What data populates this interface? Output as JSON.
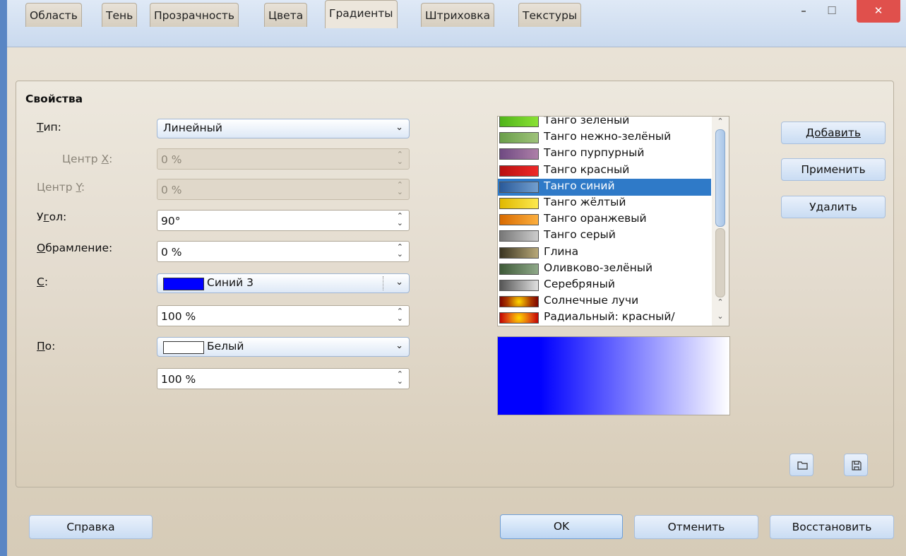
{
  "window": {
    "title": "Область",
    "minimize": "–",
    "maximize": "☐",
    "close": "✕"
  },
  "tabs": [
    "Область",
    "Тень",
    "Прозрачность",
    "Цвета",
    "Градиенты",
    "Штриховка",
    "Текстуры"
  ],
  "active_tab": "Градиенты",
  "properties": {
    "title": "Свойства",
    "type_label_u": "Т",
    "type_label_rest": "ип:",
    "type_value": "Линейный",
    "center_x_label_pre": "Центр ",
    "center_x_label_u": "X",
    "center_x_label_post": ":",
    "center_x_value": "0 %",
    "center_y_label_pre": "Центр ",
    "center_y_label_u": "Y",
    "center_y_label_post": ":",
    "center_y_value": "0 %",
    "angle_label_pre": "У",
    "angle_label_u": "г",
    "angle_label_post": "ол:",
    "angle_value": "90°",
    "border_label_u": "О",
    "border_label_rest": "брамление:",
    "border_value": "0 %",
    "from_label_u": "С",
    "from_label_post": ":",
    "from_color": "Синий 3",
    "from_swatch": "#0000ff",
    "from_intensity": "100 %",
    "to_label_u": "П",
    "to_label_rest": "о:",
    "to_color": "Белый",
    "to_swatch": "#ffffff",
    "to_intensity": "100 %"
  },
  "gradients": [
    {
      "name": "Танго зелёный",
      "swatch": "linear-gradient(90deg,#4fb31a,#8ae234)"
    },
    {
      "name": "Танго нежно-зелёный",
      "swatch": "linear-gradient(90deg,#6a9f4a,#9ec27a)"
    },
    {
      "name": "Танго пурпурный",
      "swatch": "linear-gradient(90deg,#6f4a82,#ad7fa8)"
    },
    {
      "name": "Танго красный",
      "swatch": "linear-gradient(90deg,#b81010,#ef2929)"
    },
    {
      "name": "Танго синий",
      "swatch": "linear-gradient(90deg,#2a5a9a,#729fcf)",
      "selected": true
    },
    {
      "name": "Танго жёлтый",
      "swatch": "linear-gradient(90deg,#e0b800,#fce94f)"
    },
    {
      "name": "Танго оранжевый",
      "swatch": "linear-gradient(90deg,#d86a00,#fcaf3e)"
    },
    {
      "name": "Танго серый",
      "swatch": "linear-gradient(90deg,#777,#ccc)"
    },
    {
      "name": "Глина",
      "swatch": "linear-gradient(90deg,#3a3420,#b8a878)"
    },
    {
      "name": "Оливково-зелёный",
      "swatch": "linear-gradient(90deg,#3e5a38,#8ea888)"
    },
    {
      "name": "Серебряный",
      "swatch": "linear-gradient(90deg,#555,#e0e0e0)"
    },
    {
      "name": "Солнечные лучи",
      "swatch": "radial-gradient(circle,#ffd700,#aa3a00 60%,#7a0000)"
    },
    {
      "name": "Радиальный: красный/",
      "swatch": "radial-gradient(circle,#ffd700,#e05010 60%,#c00000)"
    }
  ],
  "side_buttons": {
    "add": "Добавить",
    "apply": "Применить",
    "delete": "Удалить"
  },
  "bottom_buttons": {
    "help": "Справка",
    "ok": "OK",
    "cancel": "Отменить",
    "reset": "Восстановить"
  }
}
